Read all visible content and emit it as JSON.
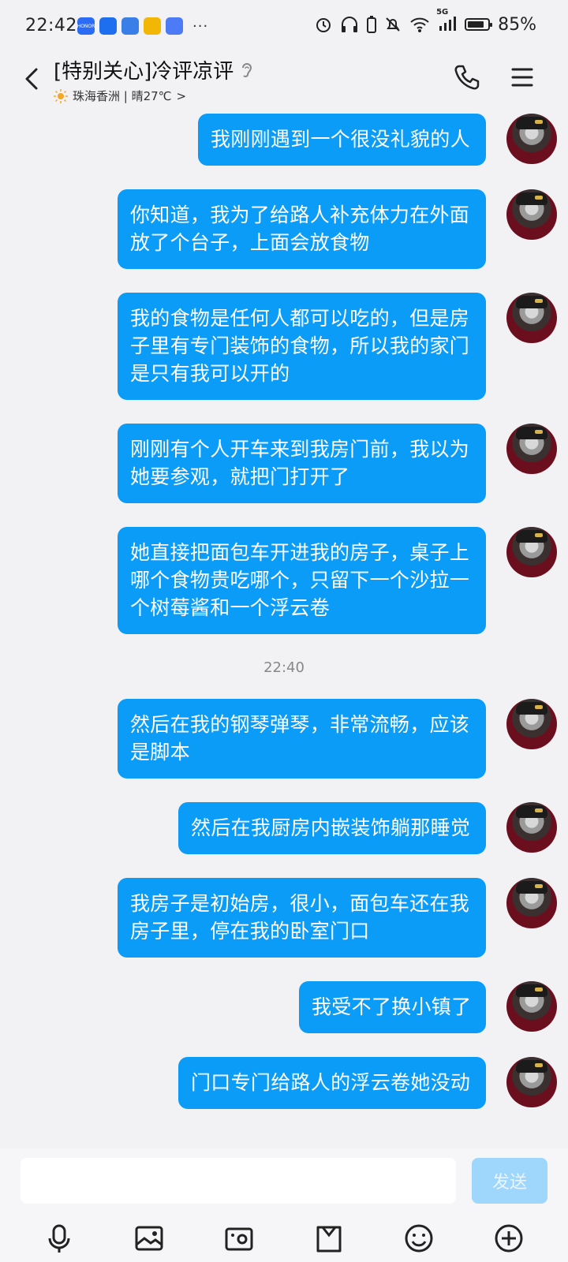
{
  "status_bar": {
    "time": "22:42",
    "app_icons": [
      {
        "name": "honor-app-icon",
        "label": "HONOR",
        "color": "#2b6cf6"
      },
      {
        "name": "feather-app-icon",
        "label": "",
        "color": "#1e6ff0"
      },
      {
        "name": "wallet-app-icon",
        "label": "",
        "color": "#3a7fe8"
      },
      {
        "name": "chrome-app-icon",
        "label": "",
        "color": "#f2b705"
      },
      {
        "name": "music-app-icon",
        "label": "",
        "color": "#4c7bf5"
      }
    ],
    "more": "···",
    "network_label": "5G",
    "battery_level": 0.85,
    "battery_text": "85%"
  },
  "header": {
    "title": "[特别关心]冷评凉评",
    "location_weather": "珠海香洲 | 晴27℃",
    "chevron": ">"
  },
  "messages": [
    {
      "type": "msg",
      "text": "我刚刚遇到一个很没礼貌的人"
    },
    {
      "type": "msg",
      "text": "你知道，我为了给路人补充体力在外面\n放了个台子，上面会放食物"
    },
    {
      "type": "msg",
      "text": "我的食物是任何人都可以吃的，但是房\n子里有专门装饰的食物，所以我的家门\n是只有我可以开的"
    },
    {
      "type": "msg",
      "text": "刚刚有个人开车来到我房门前，我以为\n她要参观，就把门打开了"
    },
    {
      "type": "msg",
      "text": "她直接把面包车开进我的房子，桌子上\n哪个食物贵吃哪个，只留下一个沙拉一\n个树莓酱和一个浮云卷"
    },
    {
      "type": "time",
      "text": "22:40"
    },
    {
      "type": "msg",
      "text": "然后在我的钢琴弹琴，非常流畅，应该\n是脚本"
    },
    {
      "type": "msg",
      "text": "然后在我厨房内嵌装饰躺那睡觉"
    },
    {
      "type": "msg",
      "text": "我房子是初始房，很小，面包车还在我\n房子里，停在我的卧室门口"
    },
    {
      "type": "msg",
      "text": "我受不了换小镇了"
    },
    {
      "type": "msg",
      "text": "门口专门给路人的浮云卷她没动"
    }
  ],
  "input": {
    "value": "",
    "send_label": "发送"
  },
  "toolbar": [
    "mic-icon",
    "image-icon",
    "camera-icon",
    "folder-icon",
    "emoji-icon",
    "plus-icon"
  ],
  "colors": {
    "bubble": "#0a9cf7",
    "background": "#f2f2f5",
    "send_disabled": "#9fd6fb"
  }
}
